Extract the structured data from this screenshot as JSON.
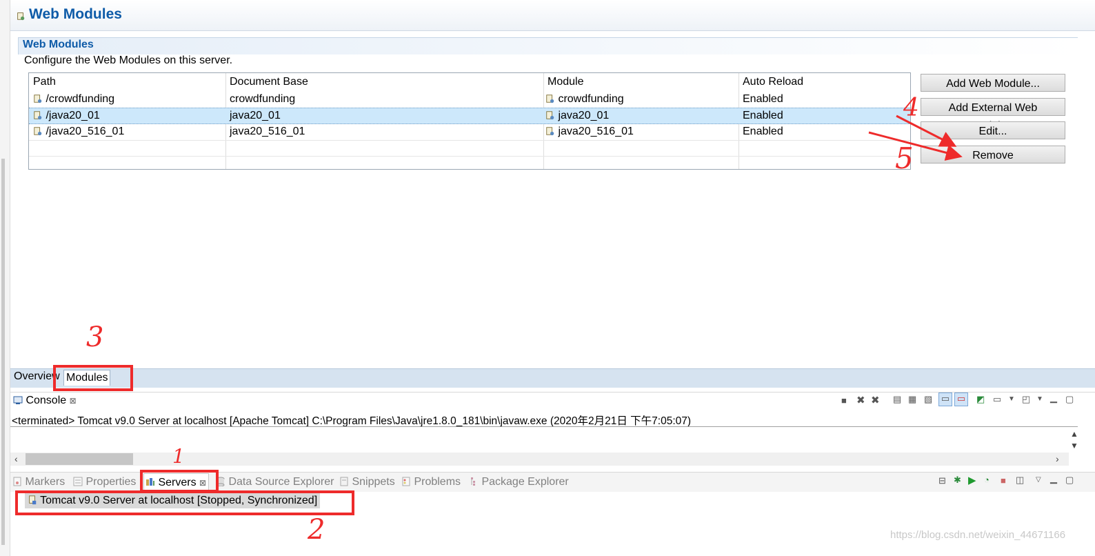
{
  "editor": {
    "title": "Web Modules",
    "section_title": "Web Modules",
    "section_description": "Configure the Web Modules on this server."
  },
  "table": {
    "columns": [
      "Path",
      "Document Base",
      "Module",
      "Auto Reload"
    ],
    "rows": [
      {
        "path": "/crowdfunding",
        "doc_base": "crowdfunding",
        "module": "crowdfunding",
        "auto_reload": "Enabled"
      },
      {
        "path": "/java20_01",
        "doc_base": "java20_01",
        "module": "java20_01",
        "auto_reload": "Enabled"
      },
      {
        "path": "/java20_516_01",
        "doc_base": "java20_516_01",
        "module": "java20_516_01",
        "auto_reload": "Enabled"
      }
    ],
    "selected_row": 1
  },
  "buttons": {
    "add_web_module": "Add Web Module...",
    "add_external_web_module": "Add External Web Module...",
    "edit": "Edit...",
    "remove": "Remove"
  },
  "editor_tabs": {
    "overview": "Overview",
    "modules": "Modules"
  },
  "console": {
    "tab_label": "Console",
    "close_glyph": "⊠",
    "terminated_line": "<terminated> Tomcat v9.0 Server at localhost [Apache Tomcat] C:\\Program Files\\Java\\jre1.8.0_181\\bin\\javaw.exe (2020年2月21日 下午7:05:07)"
  },
  "bottom_tabs": {
    "markers": "Markers",
    "properties": "Properties",
    "servers": "Servers",
    "data_source_explorer": "Data Source Explorer",
    "snippets": "Snippets",
    "problems": "Problems",
    "package_explorer": "Package Explorer"
  },
  "servers": {
    "entry": "Tomcat v9.0 Server at localhost  [Stopped, Synchronized]"
  },
  "annotations": {
    "n1": "1",
    "n2": "2",
    "n3": "3",
    "n4": "4",
    "n5": "5"
  },
  "watermark": "https://blog.csdn.net/weixin_44671166",
  "colors": {
    "accent_title": "#0e5ba8",
    "selection": "#cde8fb",
    "annotation_red": "#ee2b2b"
  }
}
